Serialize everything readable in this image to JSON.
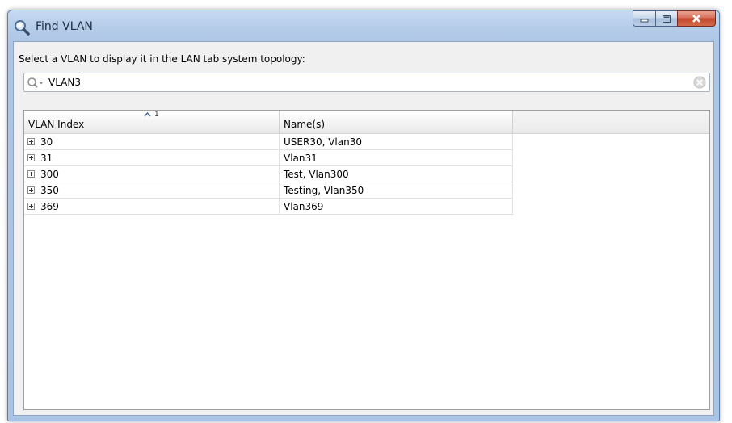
{
  "window": {
    "title": "Find VLAN"
  },
  "prompt": "Select a VLAN to display it in the LAN tab system topology:",
  "search": {
    "value": "VLAN3",
    "placeholder": ""
  },
  "table": {
    "columns": [
      {
        "label": "VLAN Index",
        "sort_order": "1"
      },
      {
        "label": "Name(s)"
      }
    ],
    "rows": [
      {
        "index": "30",
        "names": "USER30, Vlan30"
      },
      {
        "index": "31",
        "names": "Vlan31"
      },
      {
        "index": "300",
        "names": "Test, Vlan300"
      },
      {
        "index": "350",
        "names": "Testing, Vlan350"
      },
      {
        "index": "369",
        "names": "Vlan369"
      }
    ]
  },
  "icons": {
    "title": "magnifier-icon",
    "search": "search-dropdown-icon",
    "clear": "clear-circle-icon",
    "sort": "sort-ascending-icon",
    "expand": "plus-box-icon"
  },
  "colors": {
    "titlebar": "#adc6e6",
    "close_button": "#c2452c",
    "client_background": "#f0f0f0"
  }
}
